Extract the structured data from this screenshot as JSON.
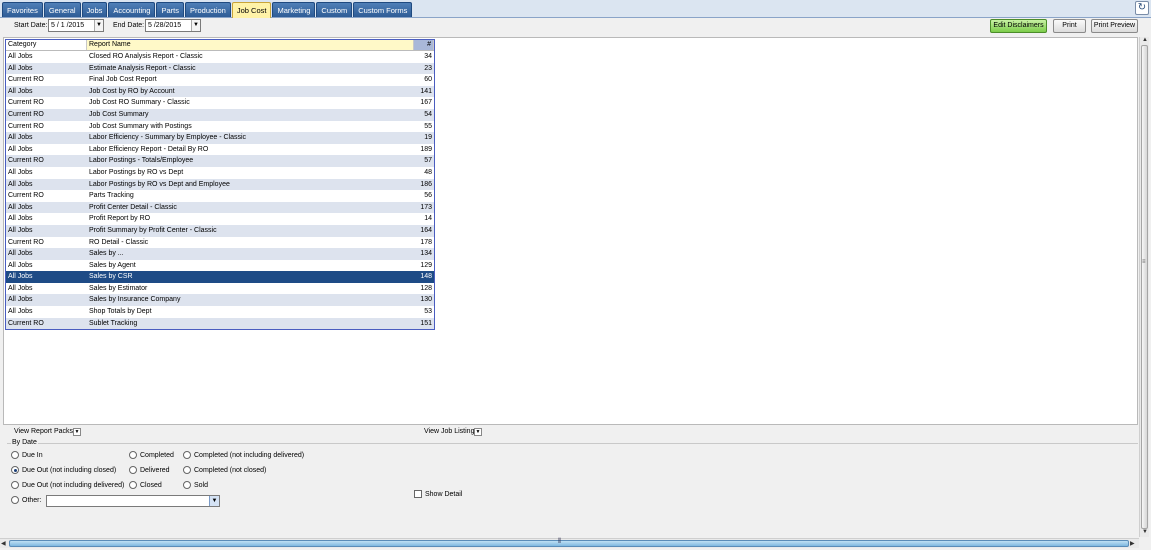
{
  "tabs": [
    "Favorites",
    "General",
    "Jobs",
    "Accounting",
    "Parts",
    "Production",
    "Job Cost",
    "Marketing",
    "Custom",
    "Custom Forms"
  ],
  "active_tab": "Job Cost",
  "toolbar": {
    "start_label": "Start Date:",
    "start_value": "5 / 1 /2015",
    "end_label": "End Date:",
    "end_value": "5 /28/2015",
    "edit_disclaimers": "Edit Disclaimers",
    "print": "Print",
    "print_preview": "Print Preview"
  },
  "grid": {
    "headers": {
      "category": "Category",
      "name": "Report Name",
      "num": "#"
    },
    "rows": [
      {
        "category": "All Jobs",
        "name": "Closed RO Analysis Report - Classic",
        "num": "34"
      },
      {
        "category": "All Jobs",
        "name": "Estimate Analysis Report - Classic",
        "num": "23"
      },
      {
        "category": "Current RO",
        "name": "Final Job Cost Report",
        "num": "60"
      },
      {
        "category": "All Jobs",
        "name": "Job Cost by RO by Account",
        "num": "141"
      },
      {
        "category": "Current RO",
        "name": "Job Cost RO Summary - Classic",
        "num": "167"
      },
      {
        "category": "Current RO",
        "name": "Job Cost Summary",
        "num": "54"
      },
      {
        "category": "Current RO",
        "name": "Job Cost Summary with Postings",
        "num": "55"
      },
      {
        "category": "All Jobs",
        "name": "Labor Efficiency - Summary by Employee - Classic",
        "num": "19"
      },
      {
        "category": "All Jobs",
        "name": "Labor Efficiency Report - Detail By RO",
        "num": "189"
      },
      {
        "category": "Current RO",
        "name": "Labor Postings - Totals/Employee",
        "num": "57"
      },
      {
        "category": "All Jobs",
        "name": "Labor Postings by RO vs Dept",
        "num": "48"
      },
      {
        "category": "All Jobs",
        "name": "Labor Postings by RO vs Dept and Employee",
        "num": "186"
      },
      {
        "category": "Current RO",
        "name": "Parts Tracking",
        "num": "56"
      },
      {
        "category": "All Jobs",
        "name": "Profit Center Detail - Classic",
        "num": "173"
      },
      {
        "category": "All Jobs",
        "name": "Profit Report by RO",
        "num": "14"
      },
      {
        "category": "All Jobs",
        "name": "Profit Summary by Profit Center - Classic",
        "num": "164"
      },
      {
        "category": "Current RO",
        "name": "RO Detail - Classic",
        "num": "178"
      },
      {
        "category": "All Jobs",
        "name": "Sales by ...",
        "num": "134"
      },
      {
        "category": "All Jobs",
        "name": "Sales by Agent",
        "num": "129"
      },
      {
        "category": "All Jobs",
        "name": "Sales by CSR",
        "num": "148"
      },
      {
        "category": "All Jobs",
        "name": "Sales by Estimator",
        "num": "128"
      },
      {
        "category": "All Jobs",
        "name": "Sales by Insurance Company",
        "num": "130"
      },
      {
        "category": "All Jobs",
        "name": "Shop Totals by Dept",
        "num": "53"
      },
      {
        "category": "Current RO",
        "name": "Sublet Tracking",
        "num": "151"
      }
    ],
    "selected_index": 19
  },
  "options": {
    "view_report_packs": "View Report Packs:",
    "view_job_listing": "View Job Listing:",
    "by_date_title": "By Date",
    "radios": {
      "due_in": "Due In",
      "due_out_not_closed": "Due Out (not including closed)",
      "due_out_not_delivered": "Due Out (not including delivered)",
      "other": "Other:",
      "completed": "Completed",
      "delivered": "Delivered",
      "closed": "Closed",
      "completed_not_delivered": "Completed (not including delivered)",
      "completed_not_closed": "Completed (not closed)",
      "sold": "Sold"
    },
    "selected_radio": "due_out_not_closed",
    "other_value": "",
    "show_detail": "Show Detail",
    "show_detail_checked": false
  }
}
